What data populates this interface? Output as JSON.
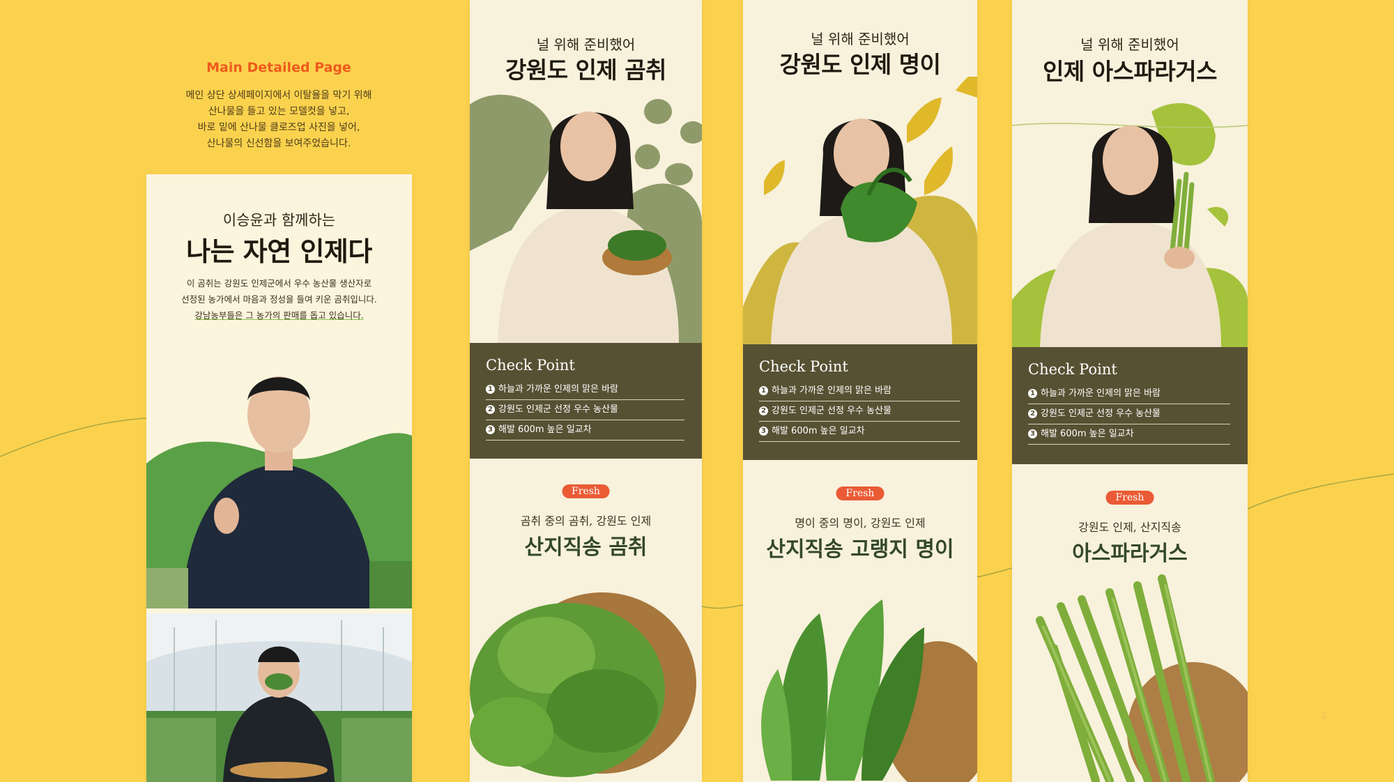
{
  "intro": {
    "title": "Main Detailed Page",
    "desc": [
      "메인 상단 상세페이지에서 이탈율을 막기 위해",
      "산나물을 들고 있는 모델컷을 넣고,",
      "바로 밑에 산나물 클로즈업 사진을 넣어,",
      "산나물의 신선함을 보여주었습니다."
    ]
  },
  "panel0": {
    "sub": "이승윤과 함께하는",
    "head": "나는 자연 인제다",
    "desc": [
      "이 곰취는 강원도 인제군에서 우수 농산물 생산자로",
      "선정된 농가에서 마음과 정성을 들여 키운 곰취입니다.",
      "강남농부들은 그 농가의 판매를 돕고 있습니다."
    ]
  },
  "panels": [
    {
      "sub": "널 위해 준비했어",
      "head": "강원도 인제 곰취",
      "cp_title": "Check Point",
      "items": [
        "하늘과 가까운 인제의 맑은 바람",
        "강원도 인제군 선정 우수 농산물",
        "해발 600m 높은 일교차"
      ],
      "fresh": "Fresh",
      "sub2": "곰취 중의 곰취, 강원도 인제",
      "head2": "산지직송 곰취"
    },
    {
      "sub": "널 위해 준비했어",
      "head": "강원도 인제 명이",
      "cp_title": "Check Point",
      "items": [
        "하늘과 가까운 인제의 맑은 바람",
        "강원도 인제군 선정 우수 농산물",
        "해발 600m 높은 일교차"
      ],
      "fresh": "Fresh",
      "sub2": "명이 중의 명이, 강원도 인제",
      "head2": "산지직송 고랭지 명이"
    },
    {
      "sub": "널 위해 준비했어",
      "head": "인제 아스파라거스",
      "cp_title": "Check Point",
      "items": [
        "하늘과 가까운 인제의 맑은 바람",
        "강원도 인제군 선정 우수 농산물",
        "해발 600m 높은 일교차"
      ],
      "fresh": "Fresh",
      "sub2": "강원도 인제, 산지직송",
      "head2": "아스파라거스"
    }
  ],
  "page_number": "2",
  "colors": {
    "background": "#fbd24e",
    "accent": "#ef5a1d",
    "checkpoint": "#575134",
    "fresh": "#ea5b35"
  }
}
